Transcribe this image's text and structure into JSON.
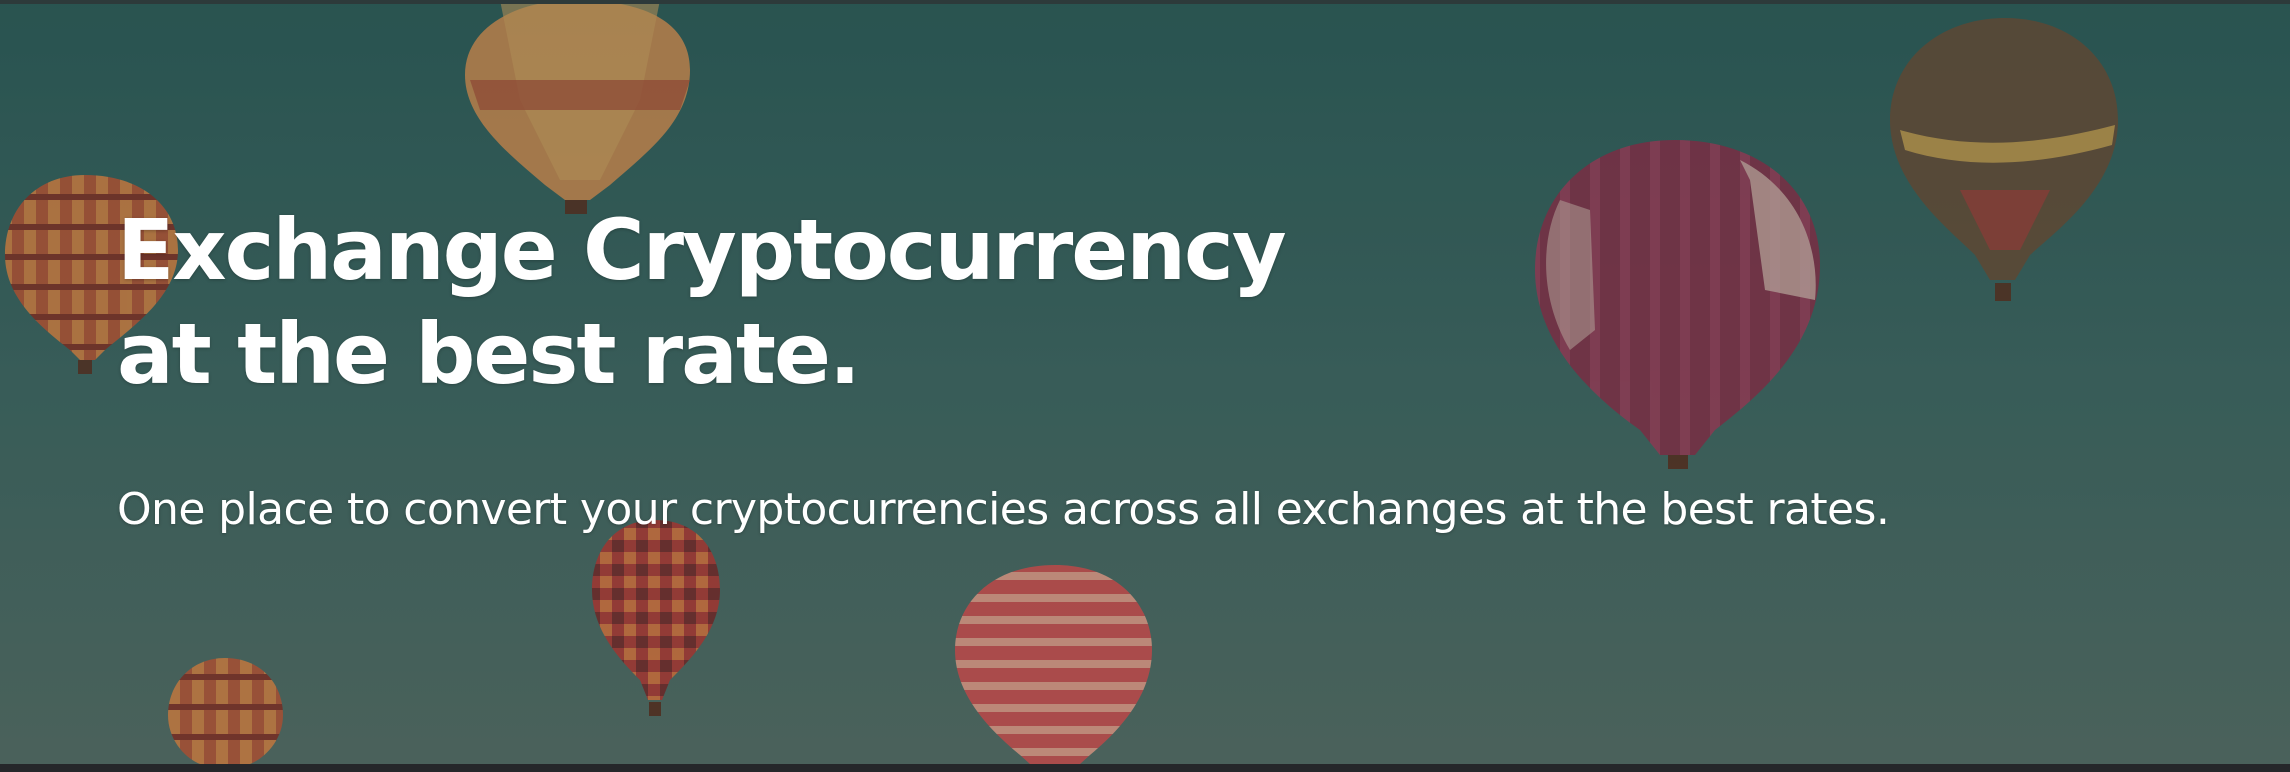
{
  "hero": {
    "title_line1": "Exchange Cryptocurrency",
    "title_line2": "at the best rate.",
    "subtitle": "One place to convert your cryptocurrencies across all exchanges at the best rates.",
    "background_image": "hot-air-balloons"
  }
}
